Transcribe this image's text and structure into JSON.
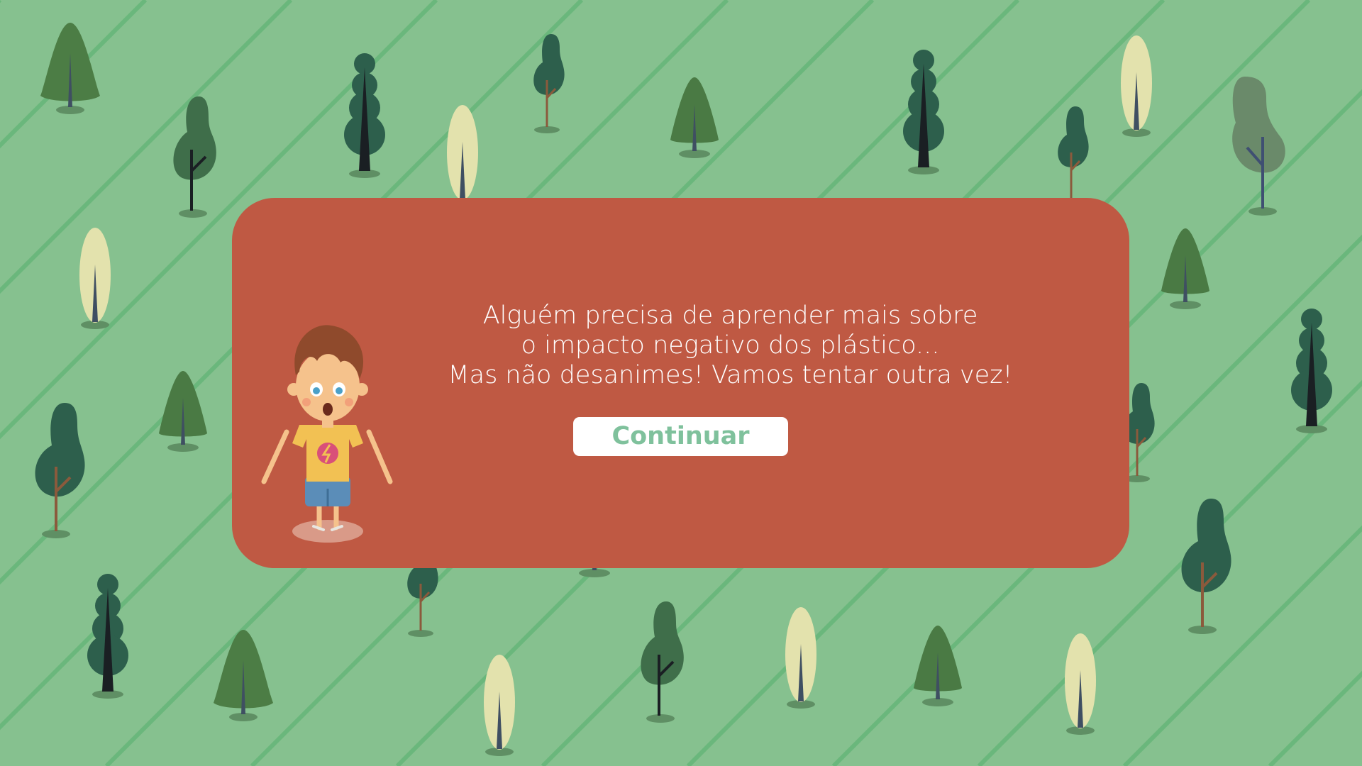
{
  "dialog": {
    "message_line_1": "Alguém precisa de aprender mais sobre",
    "message_line_2": "o impacto negativo dos plástico...",
    "message_line_3": "Mas não desanimes! Vamos tentar outra vez!",
    "continue_label": "Continuar"
  },
  "colors": {
    "background": "#86c18f",
    "stripes": "#6ab77c",
    "dialog": "#bf5943",
    "button_text": "#7fc19c"
  }
}
